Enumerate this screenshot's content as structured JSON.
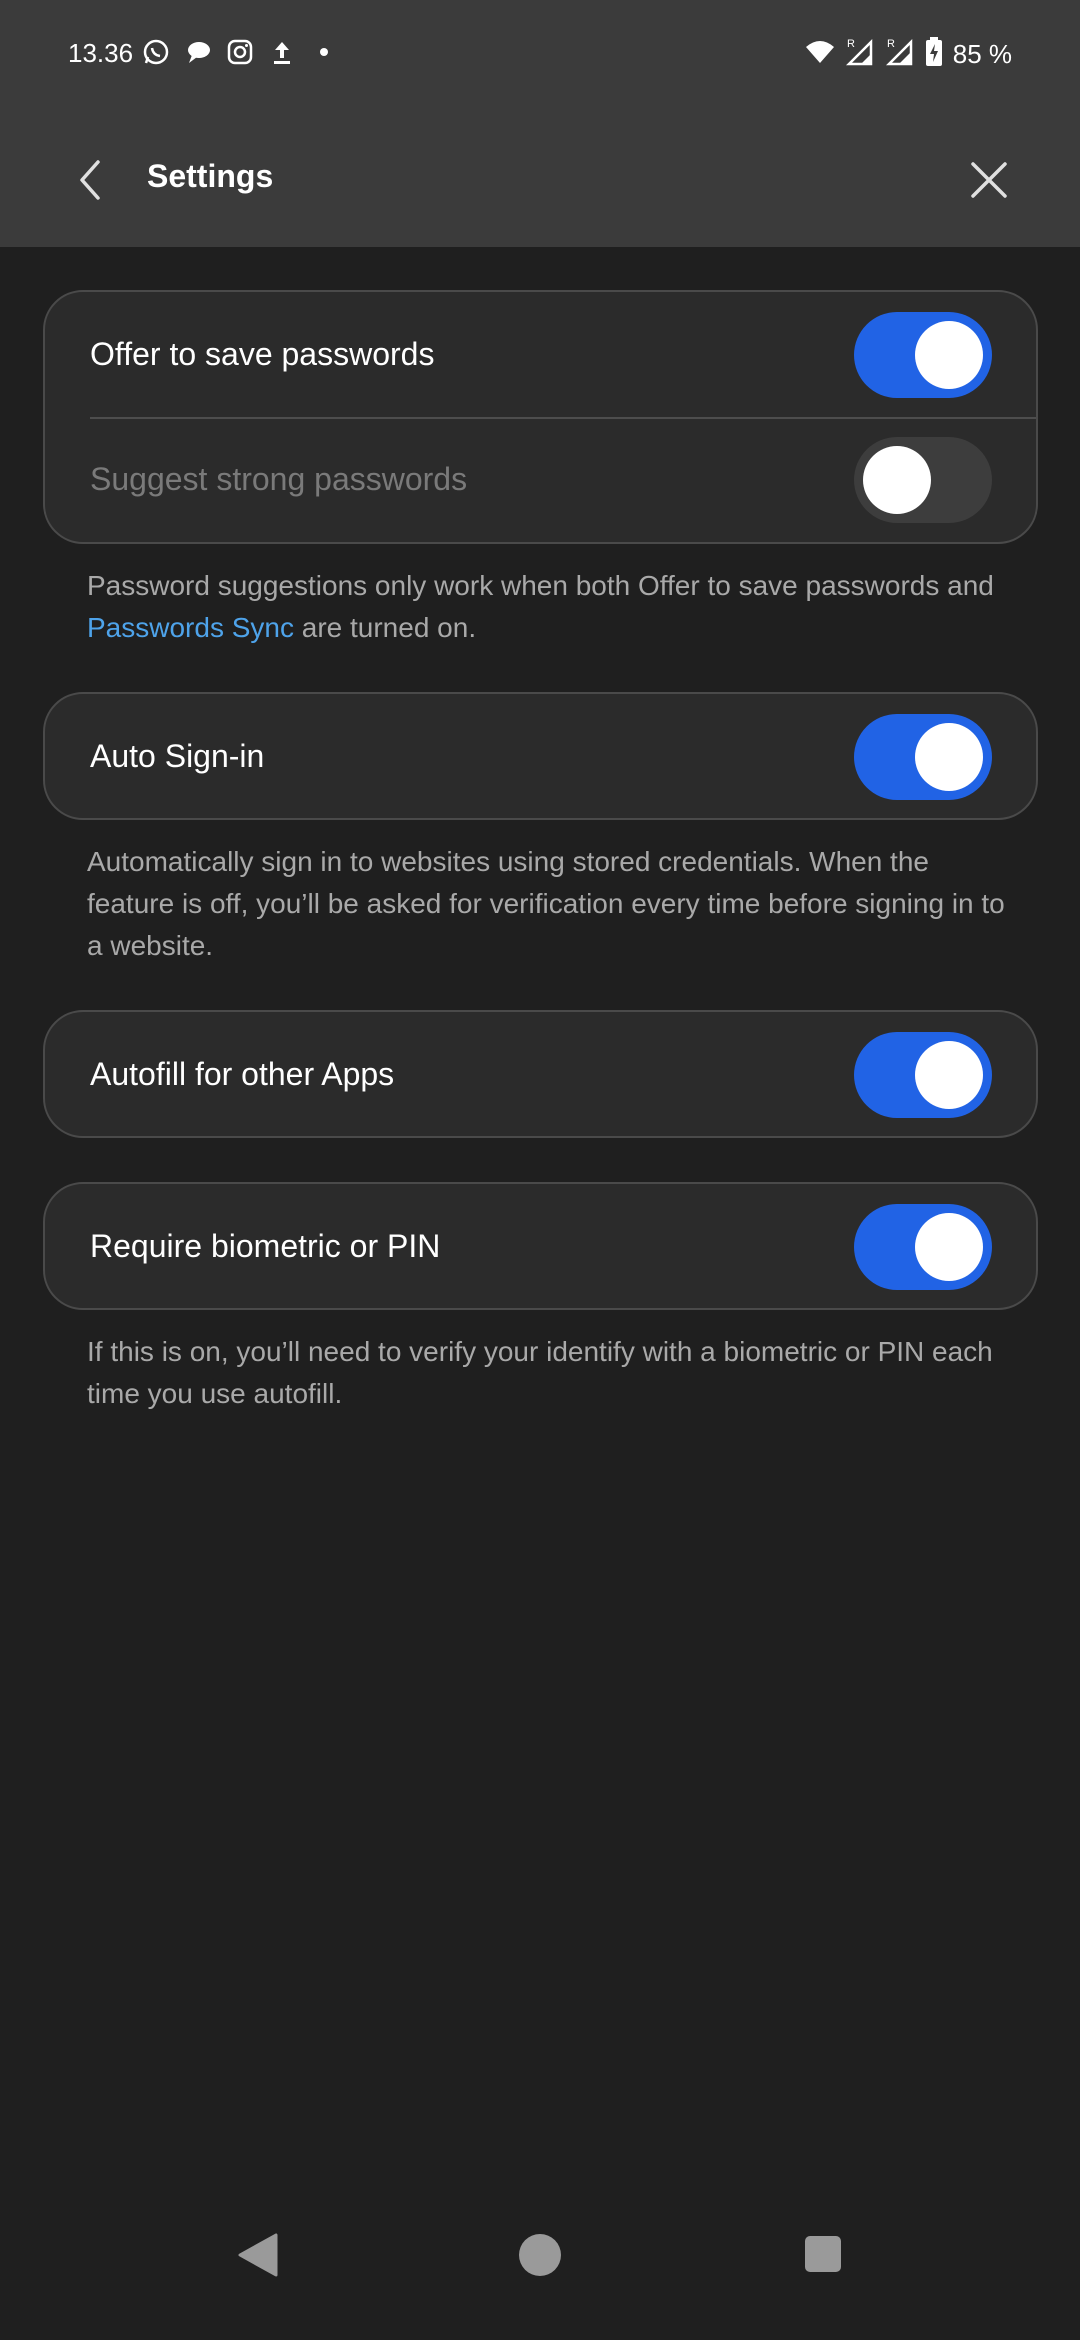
{
  "status_bar": {
    "time": "13.36",
    "left_icons": [
      "whatsapp-icon",
      "chat-bubble-icon",
      "instagram-icon",
      "upload-icon",
      "dot-icon"
    ],
    "right_icons": [
      "wifi-icon",
      "signal-r-icon",
      "signal-r-icon-2",
      "battery-charging-icon"
    ],
    "battery": "85 %"
  },
  "app_bar": {
    "title": "Settings",
    "back_icon": "chevron-left-icon",
    "close_icon": "close-icon"
  },
  "sections": {
    "passwords": {
      "offer_to_save": {
        "label": "Offer to save passwords",
        "enabled": true
      },
      "suggest_strong": {
        "label": "Suggest strong passwords",
        "enabled": false,
        "disabled": true
      },
      "note_before_link": "Password suggestions only work when both Offer to save passwords and ",
      "note_link": "Passwords Sync",
      "note_after_link": " are turned on."
    },
    "auto_signin": {
      "label": "Auto Sign-in",
      "enabled": true,
      "note": "Automatically sign in to websites using stored credentials. When the feature is off, you’ll be asked for verification every time before signing in to a website."
    },
    "autofill_apps": {
      "label": "Autofill for other Apps",
      "enabled": true
    },
    "biometric": {
      "label": "Require biometric or PIN",
      "enabled": true,
      "note": "If this is on, you’ll need to verify your identify with a biometric or PIN each time you use autofill."
    }
  },
  "colors": {
    "background": "#1f1f1f",
    "app_bar": "#3b3b3b",
    "card": "#2b2b2b",
    "toggle_on": "#2163e5",
    "link": "#4ea3ea"
  },
  "nav_bar": {
    "icons": [
      "nav-back-icon",
      "nav-home-icon",
      "nav-recents-icon"
    ]
  }
}
